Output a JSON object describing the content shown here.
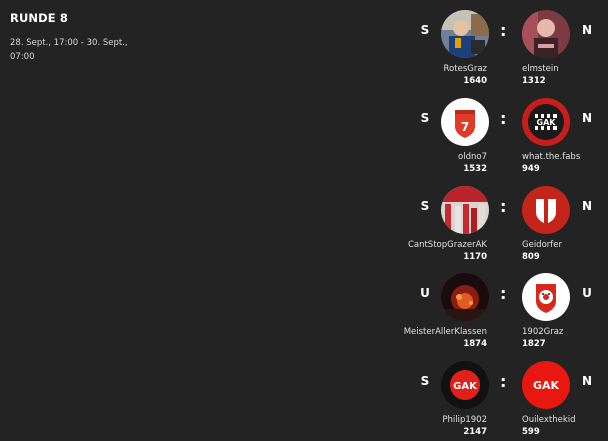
{
  "round": {
    "title": "RUNDE 8",
    "dates": "28. Sept., 17:00 - 30. Sept., 07:00"
  },
  "separator": ":",
  "matches": [
    {
      "home": {
        "name": "RotesGraz",
        "score": "1640",
        "result": "S",
        "avatar": "photo-avatar"
      },
      "away": {
        "name": "elmstein",
        "score": "1312",
        "result": "N",
        "avatar": "photo-avatar"
      }
    },
    {
      "home": {
        "name": "oldno7",
        "score": "1532",
        "result": "S",
        "avatar": "shield-7-icon"
      },
      "away": {
        "name": "what.the.fabs",
        "score": "949",
        "result": "N",
        "avatar": "gak-crest-icon"
      }
    },
    {
      "home": {
        "name": "CantStopGrazerAK",
        "score": "1170",
        "result": "S",
        "avatar": "photo-avatar"
      },
      "away": {
        "name": "Geidorfer",
        "score": "809",
        "result": "N",
        "avatar": "shield-icon"
      }
    },
    {
      "home": {
        "name": "MeisterAllerKlassen",
        "score": "1874",
        "result": "U",
        "avatar": "photo-avatar"
      },
      "away": {
        "name": "1902Graz",
        "score": "1827",
        "result": "U",
        "avatar": "clown-badge-icon"
      }
    },
    {
      "home": {
        "name": "Philip1902",
        "score": "2147",
        "result": "S",
        "avatar": "gak-logo-icon"
      },
      "away": {
        "name": "Ouilexthekid",
        "score": "599",
        "result": "N",
        "avatar": "gak-logo-icon"
      }
    }
  ]
}
